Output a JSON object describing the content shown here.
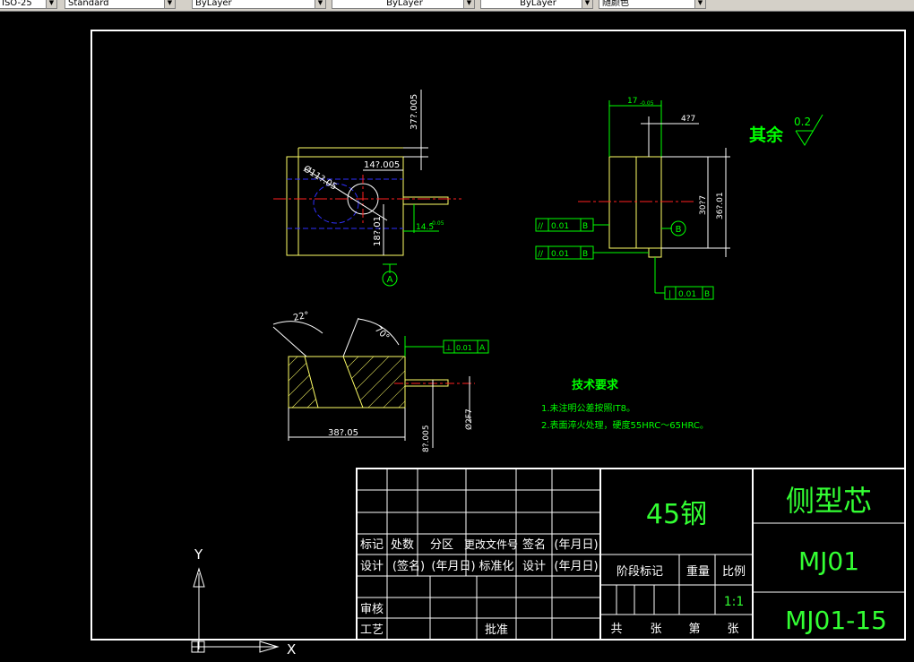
{
  "toolbar": {
    "combo1": "ISO-25",
    "combo2": "Standard",
    "combo3": "ByLayer",
    "combo4": "ByLayer",
    "combo5": "ByLayer",
    "combo6": "随颜色"
  },
  "colors": {
    "background": "#000000",
    "outline": "#ffffff",
    "part": "#ffff66",
    "dimension": "#00ff00",
    "center": "#ff2020",
    "hidden": "#3030ff",
    "table_text": "#ffffff",
    "title_text": "#33ff33"
  },
  "drawing": {
    "front_view": {
      "dim_hole": "Ø11?.05",
      "dim_14": "14?.005",
      "dim_37": "37?.005",
      "dim_18": "18?.01",
      "dim_14_5": "14.5",
      "dim_14_5_tol": "-0.05",
      "datum_a": "A"
    },
    "side_view": {
      "dim_17": "17",
      "dim_17_tol": "-0.05",
      "dim_4": "4?7",
      "dim_30": "30?7",
      "dim_36": "36?.01",
      "datum_b": "B",
      "tol1_symbol": "//",
      "tol1_value": "0.01",
      "tol1_datum": "B",
      "tol2_symbol": "//",
      "tol2_value": "0.01",
      "tol2_datum": "B",
      "tol3_symbol": "|",
      "tol3_value": "0.01",
      "tol3_datum": "B"
    },
    "section_view": {
      "angle1": "22°",
      "angle2": "70°",
      "dim_38": "38?.05",
      "dim_8": "8?.005",
      "dim_bore": "Ø2F7",
      "tol_symbol": "⊥",
      "tol_value": "0.01",
      "tol_datum": "A"
    },
    "roughness": {
      "label": "其余",
      "value": "0.2"
    },
    "tech_req": {
      "title": "技术要求",
      "line1": "1.未注明公差按照IT8。",
      "line2": "2.表面淬火处理，硬度55HRC～65HRC。"
    }
  },
  "title_block": {
    "row_labels": [
      "标记",
      "处数",
      "分区",
      "更改文件号",
      "签名",
      "(年月日)"
    ],
    "row2_labels": [
      "设计",
      "(签名)",
      "(年月日)",
      "标准化",
      "设计",
      "(年月日)"
    ],
    "review": "审核",
    "process": "工艺",
    "approve": "批准",
    "material": "45钢",
    "stage_label": "阶段标记",
    "weight_label": "重量",
    "scale_label": "比例",
    "scale_value": "1:1",
    "sheet_total": "共",
    "sheet_unit1": "张",
    "sheet_no": "第",
    "sheet_unit2": "张",
    "part_name": "侧型芯",
    "code": "MJ01",
    "drawing_no": "MJ01-15"
  },
  "ucs": {
    "y_label": "Y",
    "x_label": "X"
  }
}
